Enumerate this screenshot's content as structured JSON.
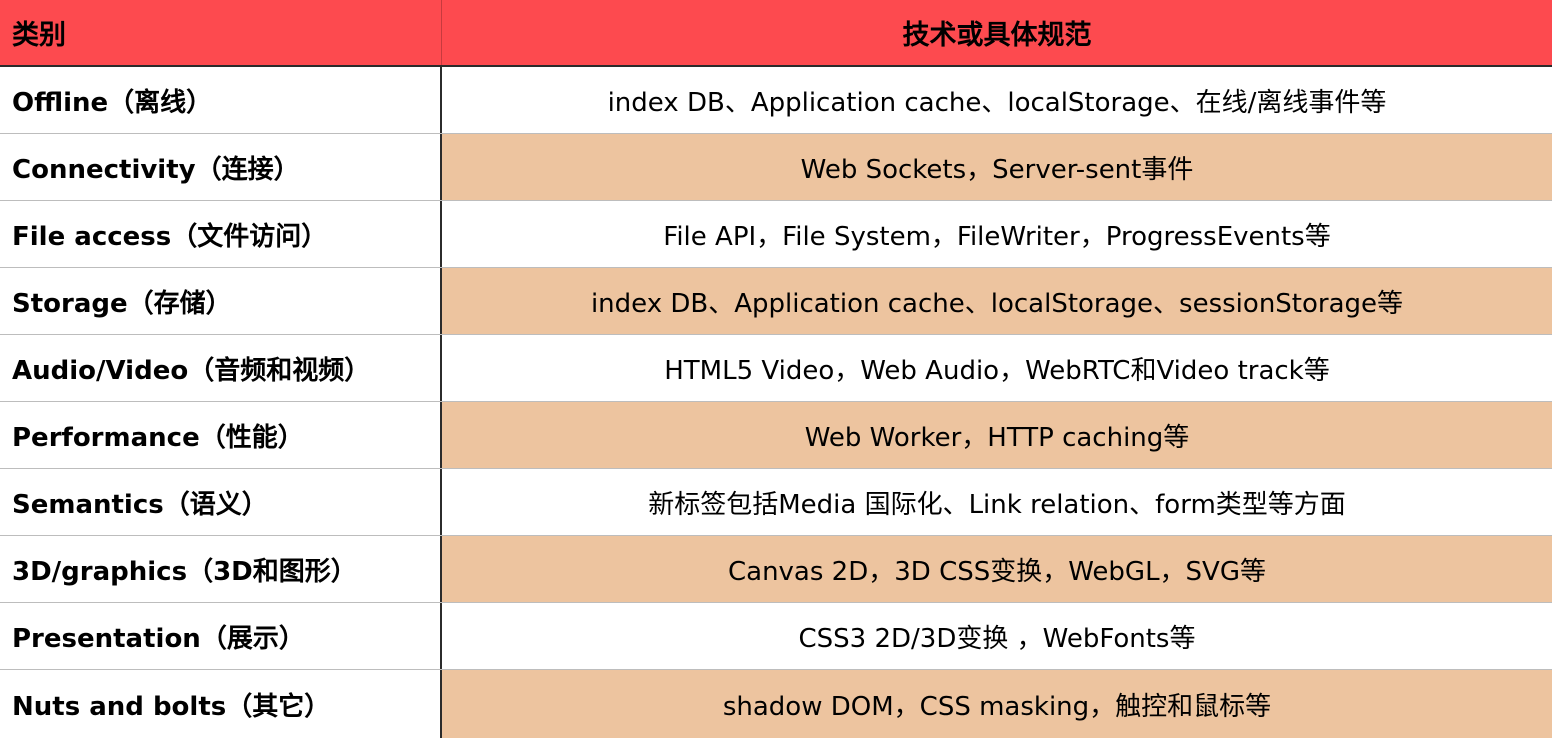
{
  "header": {
    "category": "类别",
    "technology": "技术或具体规范"
  },
  "rows": [
    {
      "category": "Offline（离线）",
      "technology": "index DB、Application cache、localStorage、在线/离线事件等",
      "shaded": false
    },
    {
      "category": "Connectivity（连接）",
      "technology": "Web Sockets，Server-sent事件",
      "shaded": true
    },
    {
      "category": "File access（文件访问）",
      "technology": "File API，File System，FileWriter，ProgressEvents等",
      "shaded": false
    },
    {
      "category": "Storage（存储）",
      "technology": "index DB、Application cache、localStorage、sessionStorage等",
      "shaded": true
    },
    {
      "category": "Audio/Video（音频和视频）",
      "technology": "HTML5 Video，Web Audio，WebRTC和Video track等",
      "shaded": false
    },
    {
      "category": "Performance（性能）",
      "technology": "Web Worker，HTTP caching等",
      "shaded": true
    },
    {
      "category": "Semantics（语义）",
      "technology": "新标签包括Media 国际化、Link relation、form类型等方面",
      "shaded": false
    },
    {
      "category": "3D/graphics（3D和图形）",
      "technology": "Canvas 2D，3D CSS变换，WebGL，SVG等",
      "shaded": true
    },
    {
      "category": "Presentation（展示）",
      "technology": "CSS3 2D/3D变换 ，WebFonts等",
      "shaded": false
    },
    {
      "category": "Nuts and bolts（其它）",
      "technology": "shadow DOM，CSS masking，触控和鼠标等",
      "shaded": true
    }
  ],
  "colors": {
    "header_bg": "#fd4a4f",
    "shaded_row_bg": "#edc49f",
    "white_row_bg": "#ffffff"
  }
}
